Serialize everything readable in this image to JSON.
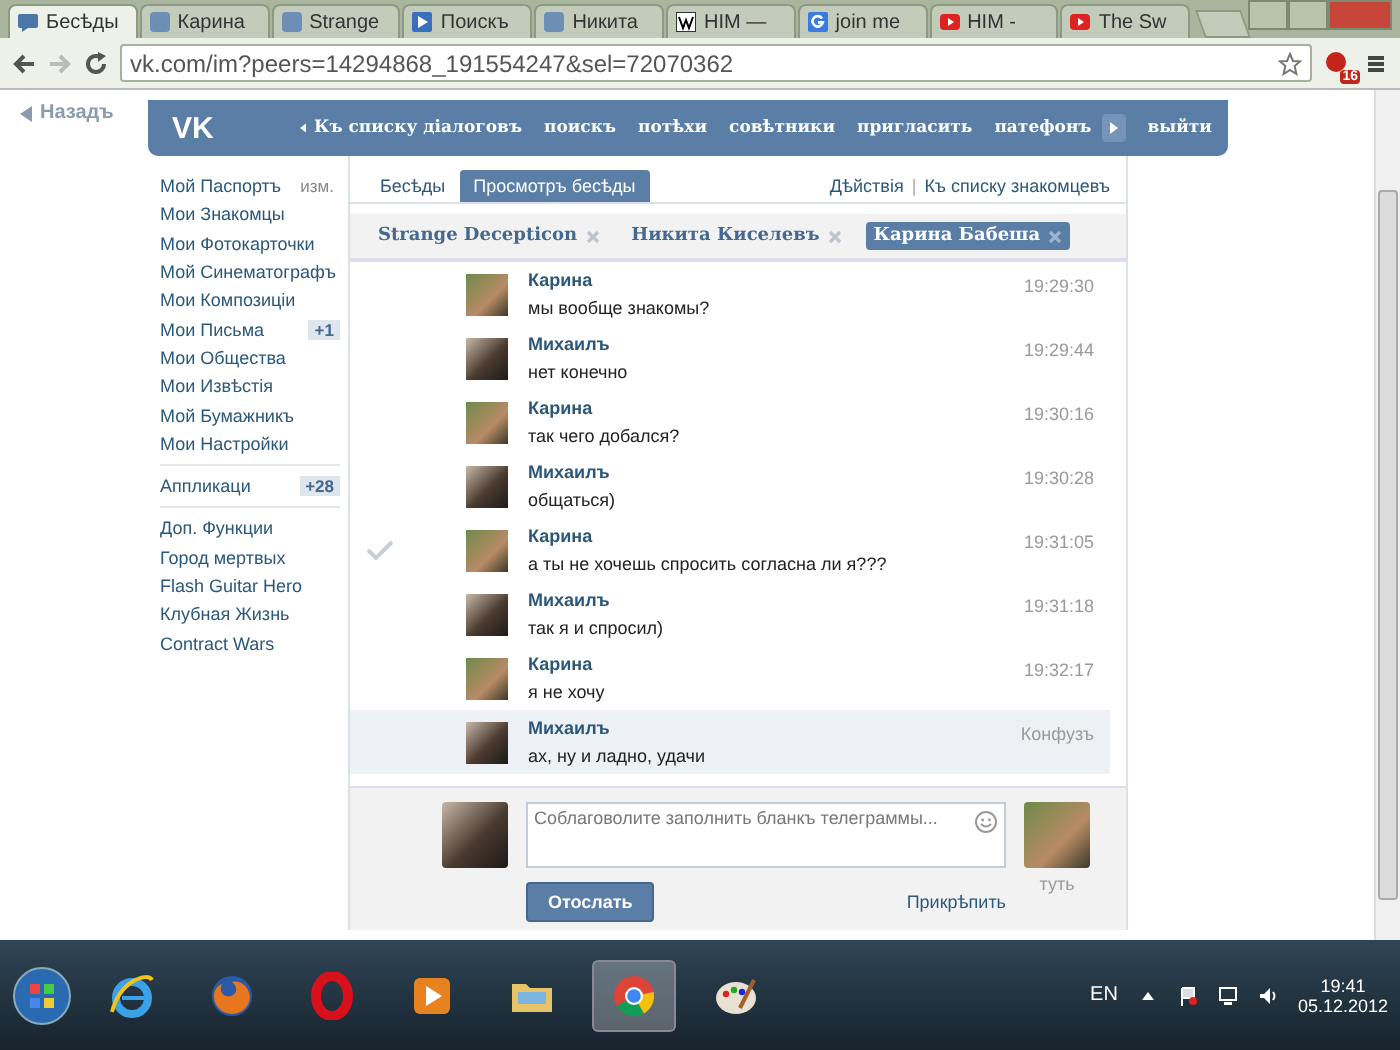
{
  "browser": {
    "tabs": [
      {
        "label": "Бесѣды",
        "selected": true
      },
      {
        "label": "Карина",
        "selected": false
      },
      {
        "label": "Strange",
        "selected": false
      },
      {
        "label": "Поискъ",
        "selected": false
      },
      {
        "label": "Никита",
        "selected": false
      },
      {
        "label": "HIM —",
        "selected": false
      },
      {
        "label": "join me",
        "selected": false
      },
      {
        "label": "HIM -",
        "selected": false
      },
      {
        "label": "The Sw",
        "selected": false
      }
    ],
    "url": "vk.com/im?peers=14294868_191554247&sel=72070362",
    "extension_badge": "16"
  },
  "back_link": "Назадъ",
  "header": {
    "logo": "VK",
    "nav": [
      "Къ списку діалоговъ",
      "поискъ",
      "потѣхи",
      "совѣтники",
      "пригласить",
      "патефонъ",
      "выйти"
    ]
  },
  "menu": [
    {
      "items": [
        {
          "label": "Мой Паспортъ",
          "badge": "изм.",
          "kind": "link"
        },
        {
          "label": "Мои Знакомцы"
        },
        {
          "label": "Мои Фотокарточки"
        },
        {
          "label": "Мой Синематографъ"
        },
        {
          "label": "Мои Композиціи"
        },
        {
          "label": "Мои Письма",
          "badge": "+1",
          "kind": "count"
        },
        {
          "label": "Мои Общества"
        },
        {
          "label": "Мои Извѣстія"
        },
        {
          "label": "Мой Бумажникъ"
        },
        {
          "label": "Мои Настройки"
        }
      ]
    },
    {
      "items": [
        {
          "label": "Аппликаци",
          "badge": "+28",
          "kind": "count"
        }
      ]
    },
    {
      "items": [
        {
          "label": "Доп. Функции"
        },
        {
          "label": "Город мертвых"
        },
        {
          "label": "Flash Guitar Hero"
        },
        {
          "label": "Клубная Жизнь"
        },
        {
          "label": "Contract Wars"
        }
      ]
    }
  ],
  "tabs": [
    {
      "label": "Бесѣды",
      "selected": false
    },
    {
      "label": "Просмотръ бесѣды",
      "selected": true
    }
  ],
  "actions": [
    "Дѣйствія",
    "|",
    "Къ списку знакомцевъ"
  ],
  "conversations": [
    {
      "label": "Strange Decepticon",
      "selected": false
    },
    {
      "label": "Никита Киселевъ",
      "selected": false
    },
    {
      "label": "Карина Бабеша",
      "selected": true
    }
  ],
  "messages": [
    {
      "author": "Карина",
      "text": "мы вообще знакомы?",
      "time": "19:29:30",
      "kind": "incoming",
      "marked": false,
      "highlighted": false
    },
    {
      "author": "Михаилъ",
      "text": "нет конечно",
      "time": "19:29:44",
      "kind": "outgoing",
      "marked": false,
      "highlighted": false
    },
    {
      "author": "Карина",
      "text": "так чего добался?",
      "time": "19:30:16",
      "kind": "incoming",
      "marked": false,
      "highlighted": false
    },
    {
      "author": "Михаилъ",
      "text": "общаться)",
      "time": "19:30:28",
      "kind": "outgoing",
      "marked": false,
      "highlighted": false
    },
    {
      "author": "Карина",
      "text": "а ты не хочешь спросить согласна ли я???",
      "time": "19:31:05",
      "kind": "incoming",
      "marked": true,
      "highlighted": false
    },
    {
      "author": "Михаилъ",
      "text": "так я и спросил)",
      "time": "19:31:18",
      "kind": "outgoing",
      "marked": false,
      "highlighted": false
    },
    {
      "author": "Карина",
      "text": "я не хочу",
      "time": "19:32:17",
      "kind": "incoming",
      "marked": false,
      "highlighted": false
    },
    {
      "author": "Михаилъ",
      "text": "ах, ну и ладно, удачи",
      "time": "Конфузъ",
      "kind": "outgoing",
      "marked": false,
      "highlighted": true
    }
  ],
  "compose": {
    "placeholder": "Соблаговолите заполнить бланкъ телеграммы...",
    "send": "Отослать",
    "attach": "Прикрѣпить",
    "recipient_caption": "туть"
  },
  "taskbar": {
    "apps": [
      {
        "selected": false
      },
      {
        "selected": false
      },
      {
        "selected": false
      },
      {
        "selected": false
      },
      {
        "selected": false
      },
      {
        "selected": true
      },
      {
        "selected": false
      }
    ],
    "language": "EN",
    "time": "19:41",
    "date": "05.12.2012"
  }
}
